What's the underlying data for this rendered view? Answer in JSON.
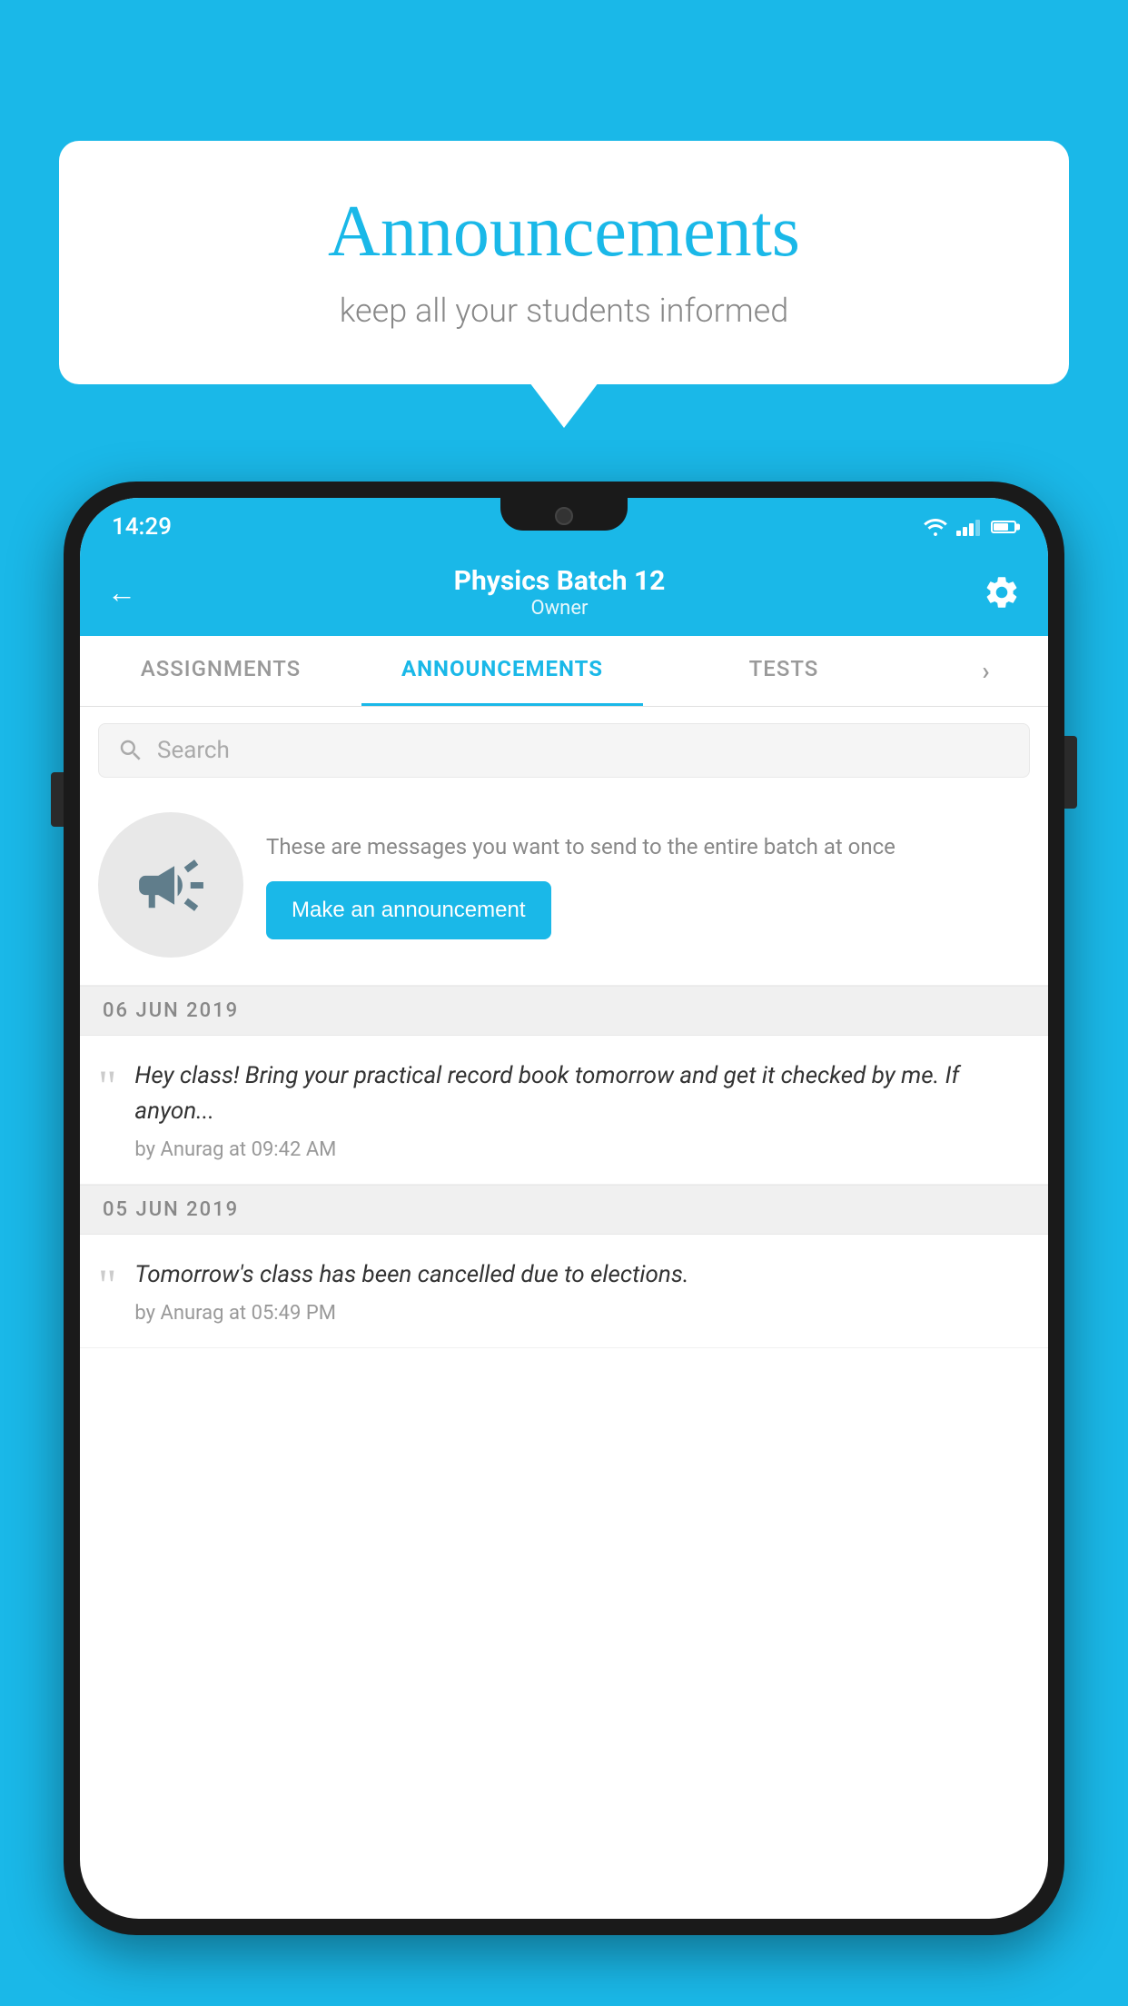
{
  "background_color": "#1ab8e8",
  "speech_bubble": {
    "title": "Announcements",
    "subtitle": "keep all your students informed"
  },
  "status_bar": {
    "time": "14:29"
  },
  "header": {
    "title": "Physics Batch 12",
    "subtitle": "Owner",
    "back_label": "←"
  },
  "tabs": [
    {
      "label": "ASSIGNMENTS",
      "active": false
    },
    {
      "label": "ANNOUNCEMENTS",
      "active": true
    },
    {
      "label": "TESTS",
      "active": false
    },
    {
      "label": "···",
      "active": false
    }
  ],
  "search": {
    "placeholder": "Search"
  },
  "announcement_prompt": {
    "description": "These are messages you want to send to the entire batch at once",
    "button_label": "Make an announcement"
  },
  "announcements": [
    {
      "date": "06  JUN  2019",
      "text": "Hey class! Bring your practical record book tomorrow and get it checked by me. If anyon...",
      "meta": "by Anurag at 09:42 AM"
    },
    {
      "date": "05  JUN  2019",
      "text": "Tomorrow's class has been cancelled due to elections.",
      "meta": "by Anurag at 05:49 PM"
    }
  ]
}
